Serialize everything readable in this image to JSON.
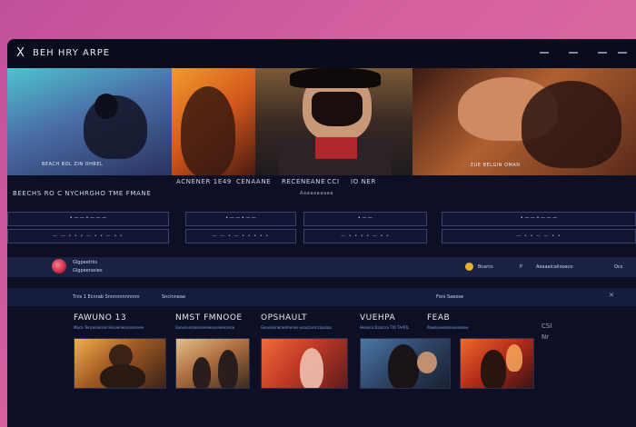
{
  "window": {
    "title": "BEH HRY ARPE",
    "close_glyph": "X"
  },
  "hero": {
    "captions": [
      "BEACH BOL ZIN OHREL",
      "EUE BELGIN OMAN"
    ]
  },
  "labels": {
    "left": "BEECHS RO C NYCHRGHO TME FMANE",
    "center": [
      "ACNENER 1E49",
      "CENAANE",
      "RECENEANE",
      "CCI",
      "IO NER"
    ],
    "center_sub": "Aaaaaaaaaa"
  },
  "controls": [
    {
      "label": "• — — • — — —"
    },
    {
      "label": "• — — • — —"
    },
    {
      "label": "• — —"
    },
    {
      "label": "• — — • — — —"
    }
  ],
  "info_rows": [
    "— — • • • — • • — • •",
    "— — • — • • • • •",
    "— • • • • — • •",
    "— • • — — • •"
  ],
  "profile": {
    "name": "Glgpeetriis",
    "handle": "Glgpeerasies",
    "right1": "Bcarcs",
    "right2": "P",
    "right3": "Aoaaalcaliooaco",
    "right4": "Ocs"
  },
  "tabs": [
    "Tnis 1 Ecnrab Snnnnnnnnnnn",
    "Sncinneae",
    "Fors Saeose"
  ],
  "sections": [
    {
      "title": "FAWUNO 13",
      "subtitle": "Muca Tenceinernel Hissieneonaneceee"
    },
    {
      "title": "NMST FMNOOE",
      "subtitle": "Saneceresessseneeonsneecesse"
    },
    {
      "title": "OPSHAULT",
      "subtitle": "Geneseineraemenee esaccarsccaasiaa"
    },
    {
      "title": "VUEHPA",
      "subtitle": "Heneca Dsaccia TIO TAATIL"
    },
    {
      "title": "FEAB",
      "subtitle": "Paweaseeaseseseseee"
    }
  ],
  "side": {
    "label1": "CSI",
    "label2": "Nr"
  }
}
